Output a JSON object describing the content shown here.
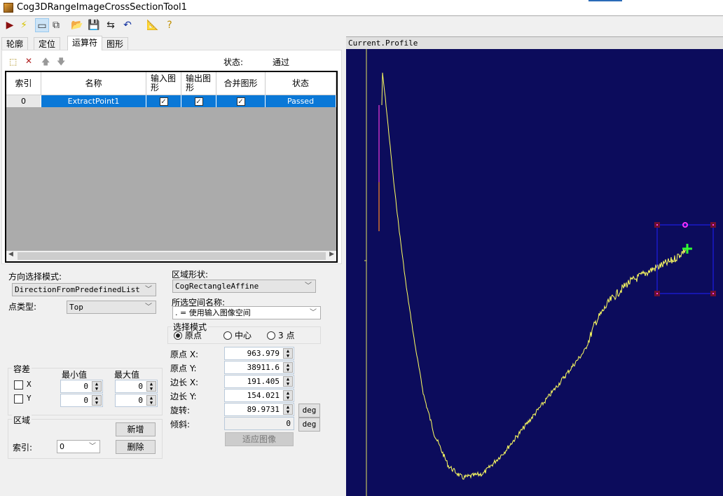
{
  "window": {
    "title": "Cog3DRangeImageCrossSectionTool1"
  },
  "toolbar": [
    {
      "icon": "run-icon",
      "glyph": "▶",
      "color": "#8b1010"
    },
    {
      "icon": "electric-icon",
      "glyph": "⚡",
      "color": "#d6c400"
    },
    {
      "icon": "show-graphics-icon",
      "glyph": "▭",
      "color": "#333"
    },
    {
      "icon": "floating-icon",
      "glyph": "⧉",
      "color": "#333"
    },
    {
      "icon": "open-icon",
      "glyph": "📂",
      "color": "#c09000"
    },
    {
      "icon": "save-icon",
      "glyph": "💾",
      "color": "#222"
    },
    {
      "icon": "save-as-icon",
      "glyph": "⇆",
      "color": "#222"
    },
    {
      "icon": "reset-icon",
      "glyph": "↶",
      "color": "#1030a0"
    },
    {
      "icon": "measure-icon",
      "glyph": "📐",
      "color": "#c0a000"
    },
    {
      "icon": "help-icon",
      "glyph": "?",
      "color": "#c09000"
    }
  ],
  "tabs": [
    {
      "label": "轮廓"
    },
    {
      "label": "定位"
    },
    {
      "label": "运算符",
      "active": true
    },
    {
      "label": "图形"
    }
  ],
  "operators": {
    "status_label": "状态:",
    "status_value": "通过",
    "columns": [
      "索引",
      "名称",
      "输入图形",
      "输出图形",
      "合并图形",
      "状态"
    ],
    "rows": [
      {
        "index": "0",
        "name": "ExtractPoint1",
        "input": true,
        "output": true,
        "merge": true,
        "status": "Passed"
      }
    ]
  },
  "direction": {
    "label": "方向选择模式:",
    "value": "DirectionFromPredefinedList"
  },
  "point_type": {
    "label": "点类型:",
    "value": "Top"
  },
  "tolerance": {
    "title": "容差",
    "min_label": "最小值",
    "max_label": "最大值",
    "rows": [
      {
        "label": "X",
        "checked": false,
        "min": "0",
        "max": "0"
      },
      {
        "label": "Y",
        "checked": false,
        "min": "0",
        "max": "0"
      }
    ]
  },
  "region_group": {
    "title": "区域",
    "add": "新增",
    "delete": "删除",
    "index_label": "索引:",
    "index_value": "0"
  },
  "region_shape": {
    "label": "区域形状:",
    "value": "CogRectangleAffine"
  },
  "space": {
    "label": "所选空间名称:",
    "value": ". = 使用输入图像空间"
  },
  "select_mode": {
    "title": "选择模式",
    "options": [
      {
        "label": "原点",
        "selected": true
      },
      {
        "label": "中心",
        "selected": false
      },
      {
        "label": "3 点",
        "selected": false
      }
    ]
  },
  "params": [
    {
      "label": "原点 X:",
      "value": "963.979"
    },
    {
      "label": "原点 Y:",
      "value": "38911.6"
    },
    {
      "label": "边长 X:",
      "value": "191.405"
    },
    {
      "label": "边长 Y:",
      "value": "154.021"
    },
    {
      "label": "旋转:",
      "value": "89.9731",
      "unit": "deg"
    },
    {
      "label": "倾斜:",
      "value": "0",
      "unit": "deg"
    }
  ],
  "fit_button": "适应图像",
  "display": {
    "title": "Current.Profile",
    "background": "#0c0c5c",
    "profile_color": "#ffff60",
    "region_color": "#2020ff",
    "point_color": "#30ff30"
  }
}
